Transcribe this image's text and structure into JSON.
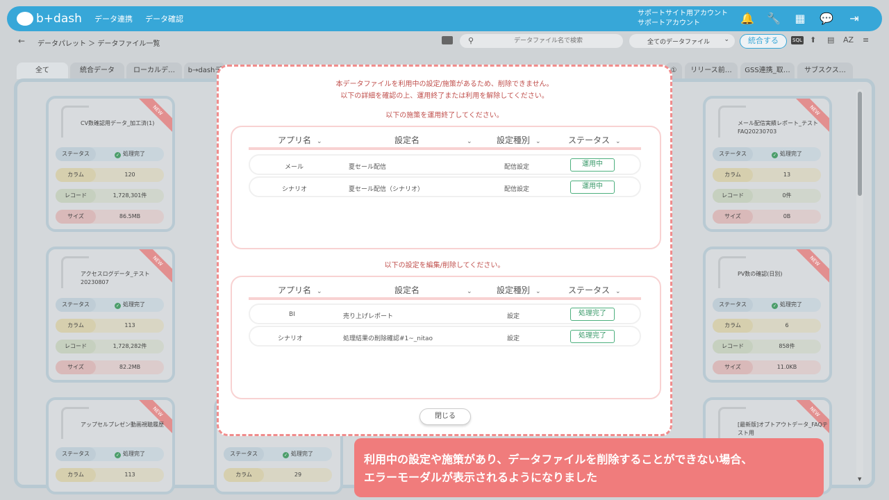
{
  "header": {
    "logo_text": "b+dash",
    "nav": [
      "データ連携",
      "データ確認"
    ],
    "account_line1": "サポートサイト用アカウント",
    "account_line2": "サポートアカウント"
  },
  "toolbar": {
    "breadcrumb": "データパレット ＞ データファイル一覧",
    "search_placeholder": "データファイル名で検索",
    "filter_value": "全てのデータファイル",
    "merge_label": "統合する",
    "sql_label": "SQL",
    "az_label": "AZ"
  },
  "tabs": [
    "全て",
    "統合データ",
    "ローカルデ…",
    "b→dashデ",
    "①",
    "リリース前…",
    "GSS連携_取…",
    "サブスクス…"
  ],
  "cards": [
    {
      "title": "CV数確認用データ_加工済(1)",
      "status": "処理完了",
      "column": "120",
      "record": "1,728,301件",
      "size": "86.5MB"
    },
    {
      "title": "メール配信実績レポート_テストFAQ20230703",
      "status": "処理完了",
      "column": "13",
      "record": "0件",
      "size": "0B"
    },
    {
      "title": "アクセスログデータ_テスト20230807",
      "status": "処理完了",
      "column": "113",
      "record": "1,728,282件",
      "size": "82.2MB"
    },
    {
      "title": "PV数の確認(日別)",
      "status": "処理完了",
      "column": "6",
      "record": "858件",
      "size": "11.0KB"
    },
    {
      "title": "アップセルプレゼン動画視聴履歴",
      "status": "処理完了",
      "column": "113"
    },
    {
      "title": "",
      "status": "処理完了",
      "column": "29"
    },
    {
      "title": "[最新版]オプトアウトデータ_FAQテスト用"
    }
  ],
  "labels": {
    "status": "ステータス",
    "column": "カラム",
    "record": "レコード",
    "size": "サイズ",
    "new": "NEW"
  },
  "modal": {
    "message_line1": "本データファイルを利用中の設定/施策があるため、削除できません。",
    "message_line2": "以下の詳細を確認の上、運用終了または利用を解除してください。",
    "section1_title": "以下の施策を運用終了してください。",
    "section2_title": "以下の設定を編集/削除してください。",
    "columns": [
      "アプリ名",
      "設定名",
      "設定種別",
      "ステータス"
    ],
    "table1": [
      {
        "app": "メール",
        "name": "夏セール配信",
        "type": "配信設定",
        "status": "運用中"
      },
      {
        "app": "シナリオ",
        "name": "夏セール配信（シナリオ）",
        "type": "配信設定",
        "status": "運用中"
      }
    ],
    "table2": [
      {
        "app": "BI",
        "name": "売り上げレポート",
        "type": "設定",
        "status": "処理完了"
      },
      {
        "app": "シナリオ",
        "name": "処理結果の削除確認#1~_nitao",
        "type": "設定",
        "status": "処理完了"
      }
    ],
    "close_label": "閉じる"
  },
  "callout": {
    "line1": "利用中の設定や施策があり、データファイルを削除することができない場合、",
    "line2": "エラーモーダルが表示されるようになりました"
  }
}
